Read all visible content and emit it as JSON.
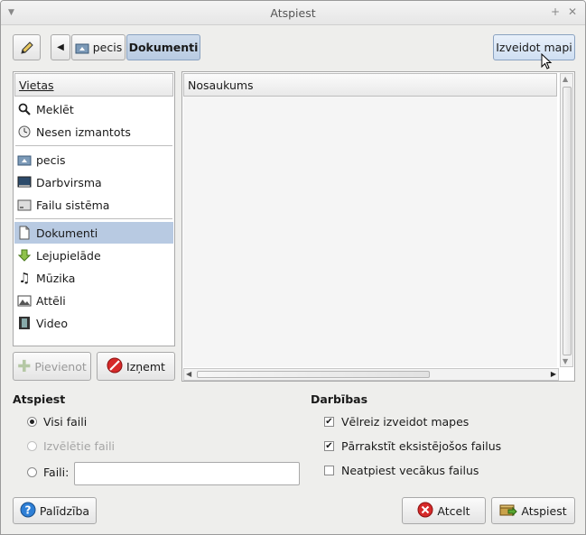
{
  "window": {
    "title": "Atspiest"
  },
  "pathbar": {
    "segments": [
      "pecis",
      "Dokumenti"
    ]
  },
  "toolbar": {
    "create_folder_label": "Izveidot mapi"
  },
  "places": {
    "header": "Vietas",
    "items": [
      "Meklēt",
      "Nesen izmantots",
      "pecis",
      "Darbvirsma",
      "Failu sistēma",
      "Dokumenti",
      "Lejupielāde",
      "Mūzika",
      "Attēli",
      "Video"
    ],
    "selected": "Dokumenti",
    "add_label": "Pievienot",
    "remove_label": "Izņemt"
  },
  "files": {
    "column_name": "Nosaukums"
  },
  "print_range": {
    "title": "Atspiest",
    "all_files": "Visi faili",
    "selected_files": "Izvēlētie faili",
    "files_label": "Faili:",
    "files_value": ""
  },
  "actions": {
    "title": "Darbības",
    "recreate_folders": "Vēlreiz izveidot mapes",
    "overwrite_files": "Pārrakstīt eksistējošos failus",
    "skip_older": "Neatpiest vecākus failus"
  },
  "buttons": {
    "help": "Palīdzība",
    "cancel": "Atcelt",
    "extract": "Atspiest"
  }
}
